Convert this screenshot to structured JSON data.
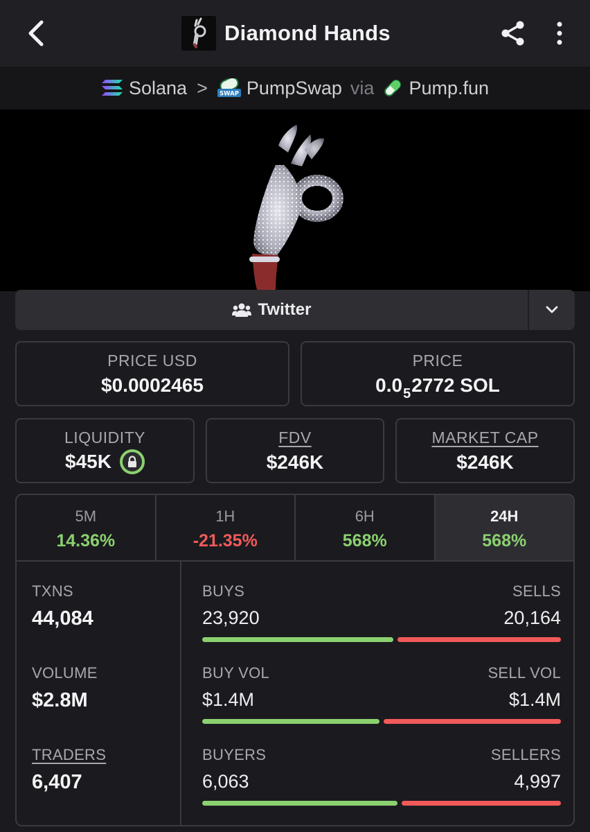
{
  "header": {
    "title": "Diamond Hands",
    "back_icon": "chevron-left-icon",
    "share_icon": "share-icon",
    "more_icon": "more-vertical-icon"
  },
  "breadcrumb": {
    "chain": "Solana",
    "separator": ">",
    "dex": "PumpSwap",
    "via": "via",
    "launchpad": "Pump.fun",
    "dex_badge": "SWAP"
  },
  "socials": {
    "twitter_label": "Twitter",
    "twitter_icon": "users-icon",
    "expand_icon": "chevron-down-icon"
  },
  "price": {
    "usd_label": "PRICE USD",
    "usd_value": "$0.0002465",
    "native_label": "PRICE",
    "native_prefix": "0.0",
    "native_zeros": "5",
    "native_suffix": "2772 SOL"
  },
  "metrics": {
    "liquidity_label": "LIQUIDITY",
    "liquidity_value": "$45K",
    "liquidity_icon": "lock-icon",
    "fdv_label": "FDV",
    "fdv_value": "$246K",
    "mcap_label": "MARKET CAP",
    "mcap_value": "$246K"
  },
  "timeframes": [
    {
      "label": "5M",
      "change": "14.36%",
      "direction": "up"
    },
    {
      "label": "1H",
      "change": "-21.35%",
      "direction": "down"
    },
    {
      "label": "6H",
      "change": "568%",
      "direction": "up"
    },
    {
      "label": "24H",
      "change": "568%",
      "direction": "up",
      "selected": true
    }
  ],
  "stats": {
    "txns_label": "TXNS",
    "txns_value": "44,084",
    "volume_label": "VOLUME",
    "volume_value": "$2.8M",
    "traders_label": "TRADERS",
    "traders_value": "6,407",
    "buys_label": "BUYS",
    "buys_value": "23,920",
    "sells_label": "SELLS",
    "sells_value": "20,164",
    "buy_vol_label": "BUY VOL",
    "buy_vol_value": "$1.4M",
    "sell_vol_label": "SELL VOL",
    "sell_vol_value": "$1.4M",
    "buyers_label": "BUYERS",
    "buyers_value": "6,063",
    "sellers_label": "SELLERS",
    "sellers_value": "4,997",
    "buys_fraction": 0.54,
    "buy_vol_fraction": 0.5,
    "buyers_fraction": 0.55
  },
  "colors": {
    "positive": "#8bd16f",
    "negative": "#f25a5a",
    "background": "#1b1b1f"
  }
}
